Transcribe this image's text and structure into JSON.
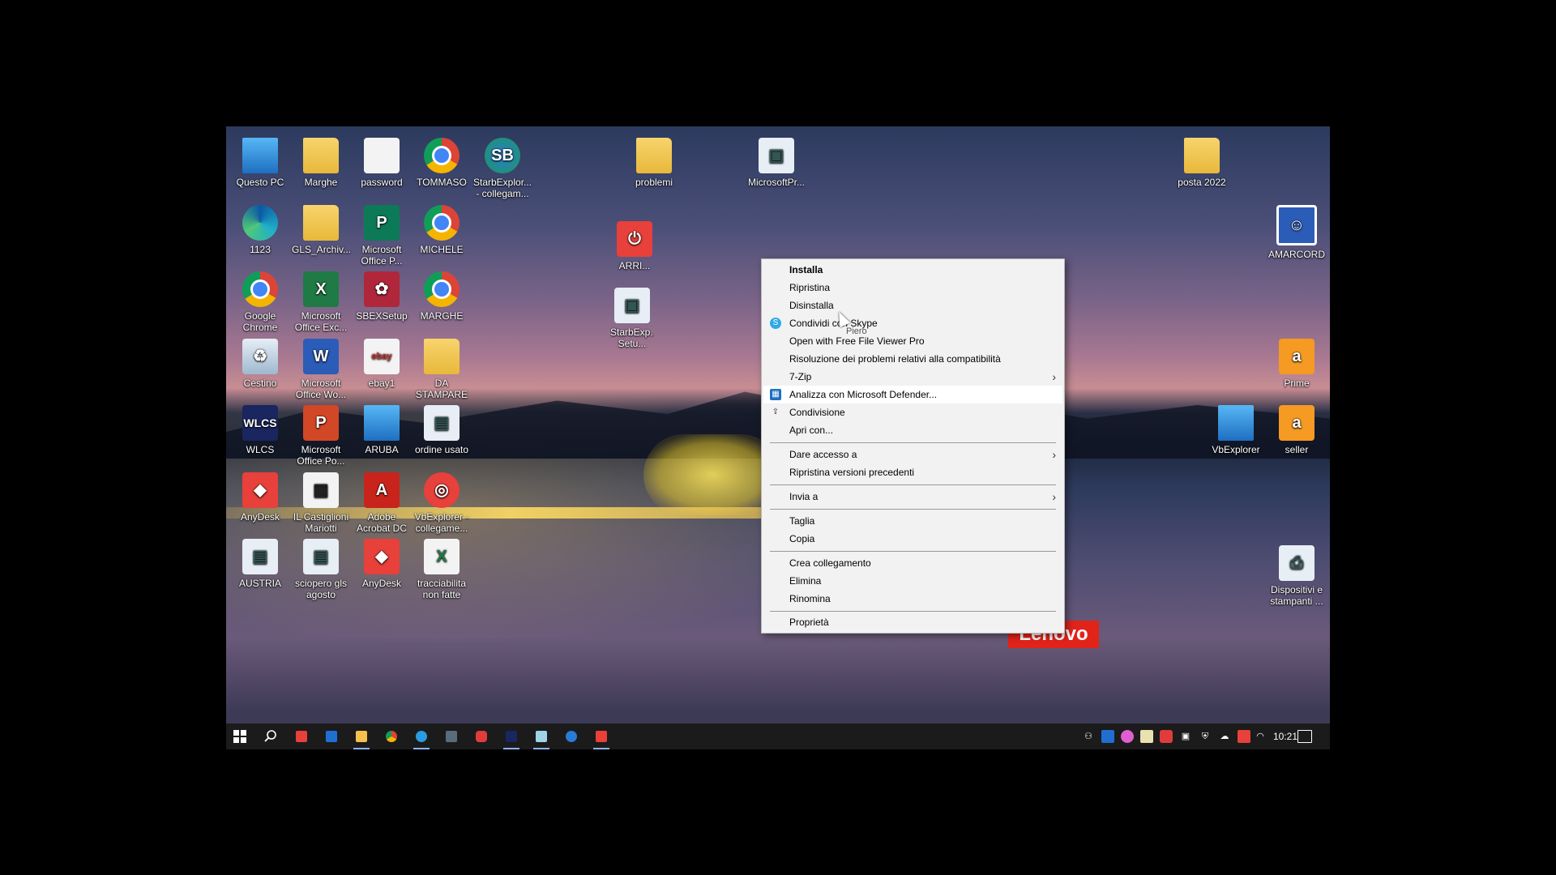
{
  "desktop": {
    "icons": [
      {
        "label": "Questo PC",
        "icon": "computer-icon"
      },
      {
        "label": "Marghe",
        "icon": "folder-icon"
      },
      {
        "label": "password",
        "icon": "text-file-icon"
      },
      {
        "label": "TOMMASO",
        "icon": "chrome-profile-icon"
      },
      {
        "label": "StarbExplor... - collegam...",
        "icon": "starbexplorer-icon"
      },
      {
        "label": "1123",
        "icon": "edge-icon"
      },
      {
        "label": "GLS_Archiv...",
        "icon": "folder-icon"
      },
      {
        "label": "Microsoft Office P...",
        "icon": "publisher-icon"
      },
      {
        "label": "MICHELE",
        "icon": "chrome-profile-icon"
      },
      {
        "label": "Google Chrome",
        "icon": "chrome-icon"
      },
      {
        "label": "Microsoft Office Exc...",
        "icon": "excel-icon"
      },
      {
        "label": "SBEXSetup",
        "icon": "setup-icon"
      },
      {
        "label": "MARGHE",
        "icon": "chrome-profile-icon"
      },
      {
        "label": "Cestino",
        "icon": "recycle-bin-icon"
      },
      {
        "label": "Microsoft Office Wo...",
        "icon": "word-icon"
      },
      {
        "label": "ebay1",
        "icon": "image-file-icon"
      },
      {
        "label": "DA STAMPARE",
        "icon": "folder-icon"
      },
      {
        "label": "WLCS",
        "icon": "wlcs-icon"
      },
      {
        "label": "Microsoft Office Po...",
        "icon": "powerpoint-icon"
      },
      {
        "label": "ARUBA",
        "icon": "network-pc-icon"
      },
      {
        "label": "ordine usato",
        "icon": "web-shortcut-icon"
      },
      {
        "label": "AnyDesk",
        "icon": "anydesk-icon"
      },
      {
        "label": "IL Castiglioni Mariotti",
        "icon": "document-icon"
      },
      {
        "label": "Adobe Acrobat DC",
        "icon": "acrobat-icon"
      },
      {
        "label": "VbExplorer - collegame...",
        "icon": "vbexplorer-shortcut-icon"
      },
      {
        "label": "AUSTRIA",
        "icon": "web-shortcut-icon"
      },
      {
        "label": "sciopero gls agosto",
        "icon": "web-shortcut-icon"
      },
      {
        "label": "AnyDesk",
        "icon": "anydesk-icon"
      },
      {
        "label": "tracciabilita non fatte",
        "icon": "excel-file-icon"
      },
      {
        "label": "problemi",
        "icon": "folder-icon"
      },
      {
        "label": "MicrosoftPr...",
        "icon": "installer-icon"
      },
      {
        "label": "ARRI...",
        "icon": "power-app-icon"
      },
      {
        "label": "StarbExp... Setu...",
        "icon": "installer-icon"
      },
      {
        "label": "posta 2022",
        "icon": "folder-icon"
      },
      {
        "label": "AMARCORD",
        "icon": "app-icon"
      },
      {
        "label": "Prime",
        "icon": "amazon-icon"
      },
      {
        "label": "VbExplorer",
        "icon": "vbexplorer-icon"
      },
      {
        "label": "seller",
        "icon": "amazon-icon"
      },
      {
        "label": "Dispositivi e stampanti ...",
        "icon": "printer-icon"
      }
    ],
    "wallpaper_brand": "Lenovo"
  },
  "context_menu": {
    "items": {
      "installa": "Installa",
      "ripristina": "Ripristina",
      "disinstalla": "Disinstalla",
      "skype": "Condividi con Skype",
      "freefileviewer": "Open with Free File Viewer Pro",
      "compat": "Risoluzione dei problemi relativi alla compatibilità",
      "zip": "7-Zip",
      "defender": "Analizza con Microsoft Defender...",
      "condivisione": "Condivisione",
      "apricon": "Apri con...",
      "dareaccesso": "Dare accesso a",
      "ripristinaversioni": "Ripristina versioni precedenti",
      "inviaa": "Invia a",
      "taglia": "Taglia",
      "copia": "Copia",
      "crea": "Crea collegamento",
      "elimina": "Elimina",
      "rinomina": "Rinomina",
      "proprieta": "Proprietà"
    },
    "tooltip": "Piero"
  },
  "taskbar": {
    "start_icon": "windows-start-icon",
    "search_icon": "search-icon",
    "clock": "10:21"
  },
  "colors": {
    "menu_bg": "#f2f2f2",
    "taskbar_bg": "#1b1b1b",
    "lenovo_red": "#e2231a"
  }
}
